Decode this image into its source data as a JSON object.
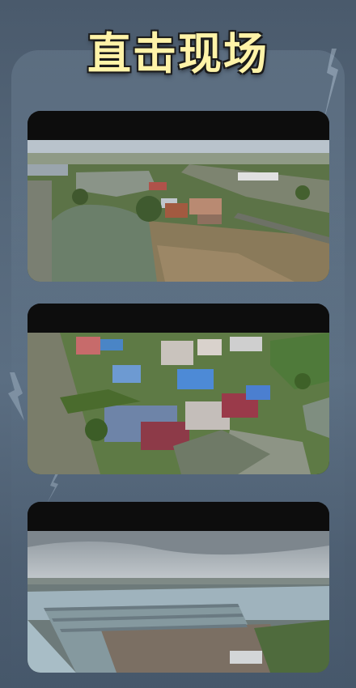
{
  "title": "直击现场",
  "cards": [
    {
      "photo": "aerial-pond-village-damaged-houses"
    },
    {
      "photo": "aerial-village-blue-roofs-canal"
    },
    {
      "photo": "aerial-greenhouses-cloudy-sky"
    }
  ],
  "colors": {
    "title_fill": "#fff3a8",
    "background": "#55677a",
    "card_header": "#0d0d0d"
  }
}
